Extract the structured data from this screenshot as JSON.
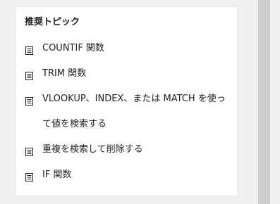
{
  "recommended": {
    "heading": "推奨トピック",
    "items": [
      {
        "label": "COUNTIF 関数",
        "icon": "document-icon"
      },
      {
        "label": "TRIM 関数",
        "icon": "document-icon"
      },
      {
        "label": "VLOOKUP、INDEX、または MATCH を使って値を検索する",
        "icon": "document-icon"
      },
      {
        "label": "重複を検索して削除する",
        "icon": "document-icon"
      },
      {
        "label": "IF 関数",
        "icon": "document-icon"
      }
    ]
  },
  "colors": {
    "background": "#f0f0f0",
    "card": "#ffffff",
    "text": "#1f1f1f",
    "scrollbar": "#cdcdcd"
  }
}
